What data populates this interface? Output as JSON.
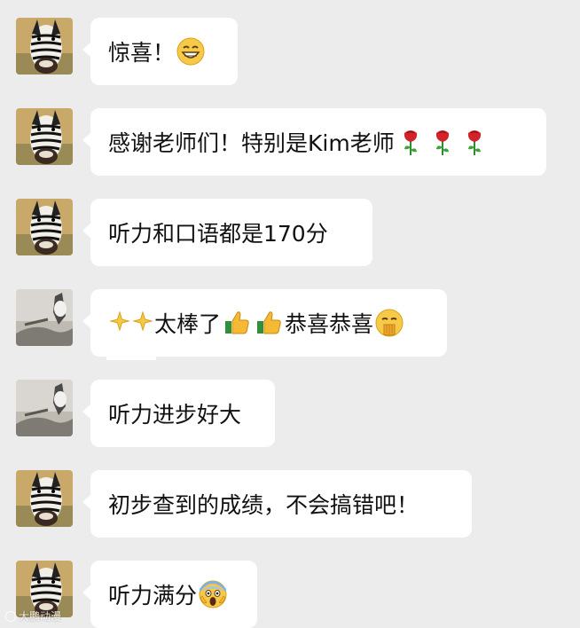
{
  "messages": [
    {
      "avatar": "zebra-avatar",
      "text": "惊喜！",
      "emojis": [
        "grin-emoji"
      ]
    },
    {
      "avatar": "zebra-avatar",
      "text": "感谢老师们！特别是Kim老师",
      "emojis": [
        "rose-emoji",
        "rose-emoji",
        "rose-emoji"
      ]
    },
    {
      "avatar": "zebra-avatar",
      "text": "听力和口语都是170分",
      "emojis": []
    },
    {
      "avatar": "photo-avatar",
      "text_before": "",
      "text_mid": "太棒了",
      "text_after": "恭喜恭喜",
      "emojis": [
        "sparkle-emoji",
        "sparkle-emoji",
        "thumbs-up-emoji",
        "thumbs-up-emoji",
        "shush-emoji"
      ]
    },
    {
      "avatar": "photo-avatar",
      "text": "听力进步好大",
      "emojis": []
    },
    {
      "avatar": "zebra-avatar",
      "text": "初步查到的成绩，不会搞错吧！",
      "emojis": []
    },
    {
      "avatar": "zebra-avatar",
      "text": "听力满分",
      "emojis": [
        "scream-emoji"
      ]
    }
  ],
  "watermark": "大鹏动漫",
  "colors": {
    "background": "#ececec",
    "bubble": "#ffffff",
    "text": "#111111"
  }
}
